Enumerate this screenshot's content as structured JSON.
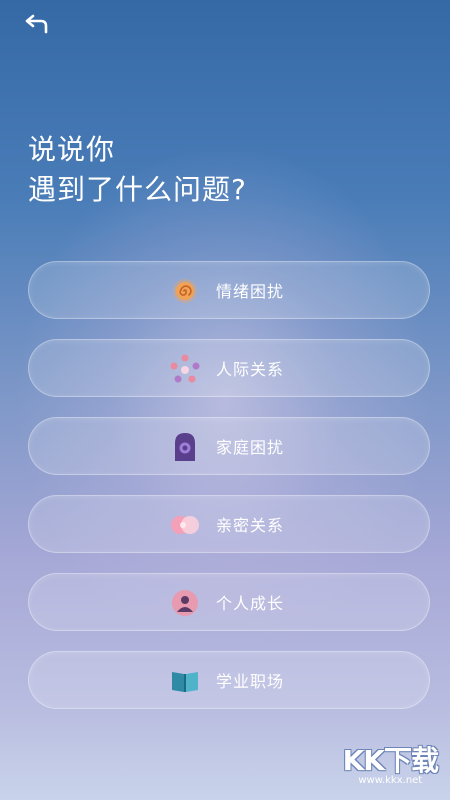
{
  "header": {
    "back_icon": "back-arrow-icon"
  },
  "heading": {
    "line1": "说说你",
    "line2": "遇到了什么问题?"
  },
  "options": [
    {
      "label": "情绪困扰",
      "icon": "swirl-icon"
    },
    {
      "label": "人际关系",
      "icon": "people-circle-icon"
    },
    {
      "label": "家庭困扰",
      "icon": "house-door-icon"
    },
    {
      "label": "亲密关系",
      "icon": "hearts-icon"
    },
    {
      "label": "个人成长",
      "icon": "person-icon"
    },
    {
      "label": "学业职场",
      "icon": "book-icon"
    }
  ],
  "watermark": {
    "main": "KK下载",
    "sub": "www.kkx.net"
  }
}
